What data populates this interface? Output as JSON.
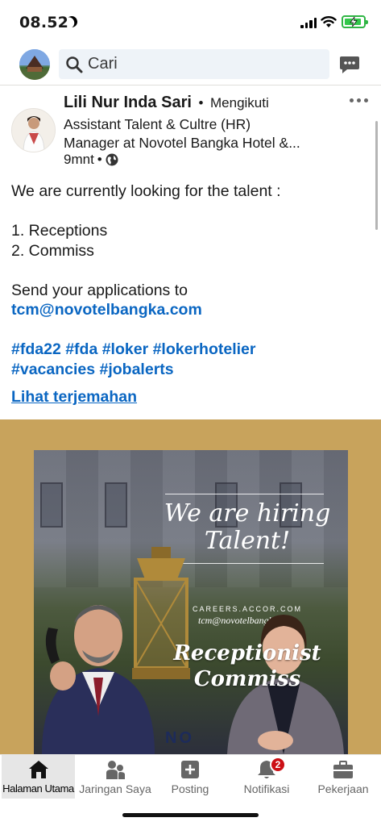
{
  "status_bar": {
    "time": "08.52"
  },
  "search": {
    "placeholder": "Cari"
  },
  "post": {
    "author": {
      "name": "Lili Nur Inda Sari",
      "separator": "•",
      "follow_status": "Mengikuti",
      "headline_line1": "Assistant Talent & Cultre (HR)",
      "headline_line2": "Manager at Novotel Bangka Hotel &...",
      "time": "9mnt",
      "time_separator": "•"
    },
    "text": {
      "intro": "We are currently looking for the talent :",
      "item1": "1. Receptions",
      "item2": "2. Commiss",
      "send": "Send your applications to",
      "email": "tcm@novotelbangka.com",
      "hashtags_line1": "#fda22 #fda #loker #lokerhotelier",
      "hashtags_line2": "#vacancies  #jobalerts",
      "see_translation": "Lihat terjemahan"
    },
    "image": {
      "headline_line1": "We are hiring",
      "headline_line2": "Talent!",
      "careers": "CAREERS.ACCOR.COM",
      "email": "tcm@novotelbangka.com",
      "role1": "Receptionist",
      "role2": "Commiss",
      "brand": "NO"
    }
  },
  "bottom_nav": {
    "items": [
      {
        "label": "Halaman Utama",
        "icon": "home-icon",
        "active": true
      },
      {
        "label": "Jaringan Saya",
        "icon": "network-icon"
      },
      {
        "label": "Posting",
        "icon": "post-plus-icon"
      },
      {
        "label": "Notifikasi",
        "icon": "bell-icon",
        "badge": "2"
      },
      {
        "label": "Pekerjaan",
        "icon": "briefcase-icon"
      }
    ]
  },
  "colors": {
    "link": "#0a66c2",
    "badge": "#cc1016",
    "image_frame": "#c8a35c"
  }
}
